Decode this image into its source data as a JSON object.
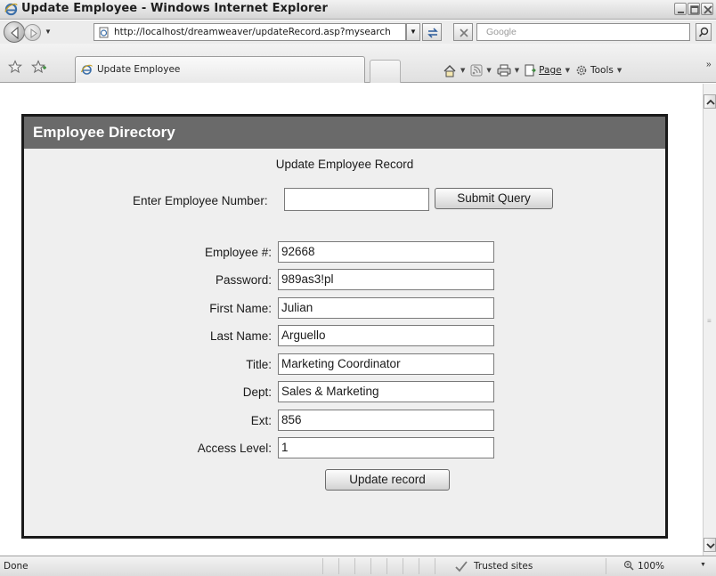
{
  "window": {
    "title": "Update Employee - Windows Internet Explorer"
  },
  "addressbar": {
    "url": "http://localhost/dreamweaver/updateRecord.asp?mysearch",
    "search_placeholder": "Google"
  },
  "tabs": [
    {
      "label": "Update Employee"
    }
  ],
  "command_bar": {
    "page_label": "Page",
    "tools_label": "Tools"
  },
  "page": {
    "header": "Employee Directory",
    "heading": "Update Employee Record",
    "query": {
      "label": "Enter Employee Number:",
      "value": "",
      "button": "Submit Query"
    },
    "fields": [
      {
        "label": "Employee #:",
        "value": "92668"
      },
      {
        "label": "Password:",
        "value": "989as3!pl"
      },
      {
        "label": "First Name:",
        "value": "Julian"
      },
      {
        "label": "Last Name:",
        "value": "Arguello"
      },
      {
        "label": "Title:",
        "value": "Marketing Coordinator"
      },
      {
        "label": "Dept:",
        "value": "Sales & Marketing"
      },
      {
        "label": "Ext:",
        "value": "856"
      },
      {
        "label": "Access Level:",
        "value": "1"
      }
    ],
    "update_button": "Update record"
  },
  "statusbar": {
    "status": "Done",
    "zone": "Trusted sites",
    "zoom": "100%"
  }
}
